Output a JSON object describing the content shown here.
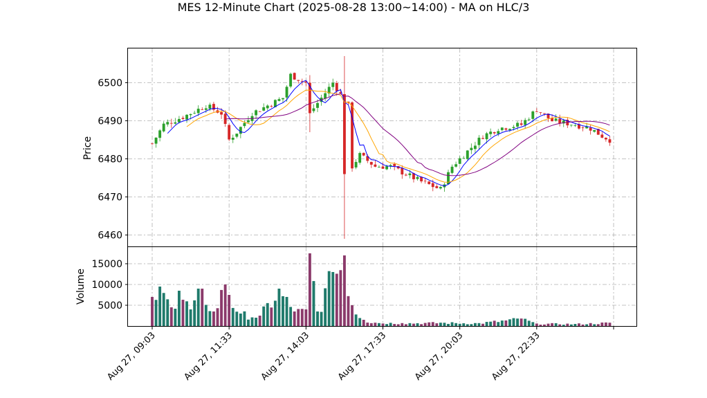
{
  "chart_data": {
    "type": "candlestick",
    "title": "MES 12-Minute Chart (2025-08-28 13:00~14:00) - MA on HLC/3",
    "price_panel": {
      "ylabel": "Price",
      "ylim": [
        6457,
        6509
      ],
      "yticks": [
        6460,
        6470,
        6480,
        6490,
        6500
      ],
      "ytick_labels": [
        "6460",
        "6470",
        "6480",
        "6490",
        "6500"
      ],
      "grid": true
    },
    "volume_panel": {
      "ylabel": "Volume",
      "ylim": [
        0,
        19000
      ],
      "yticks": [
        5000,
        10000,
        15000
      ],
      "ytick_labels": [
        "5000",
        "10000",
        "15000"
      ],
      "grid": true
    },
    "x_axis": {
      "bar_count": 120,
      "tick_indices": [
        0,
        20,
        40,
        60,
        80,
        100,
        120
      ],
      "tick_labels": [
        "Aug 27, 09:03",
        "Aug 27, 11:33",
        "Aug 27, 14:03",
        "Aug 27, 17:33",
        "Aug 27, 20:03",
        "Aug 27, 22:33",
        ""
      ]
    },
    "colors": {
      "up": "#2ca02c",
      "down": "#d62728",
      "vol_up": "#1f7a6b",
      "vol_down": "#8b3a6b",
      "ma_fast": "#0000ff",
      "ma_mid": "#ffa500",
      "ma_slow": "#800080",
      "grid": "#b0b0b0"
    },
    "close_anchors": [
      [
        0,
        6484
      ],
      [
        3,
        6489
      ],
      [
        8,
        6491
      ],
      [
        14,
        6494
      ],
      [
        18,
        6492
      ],
      [
        20,
        6485
      ],
      [
        22,
        6487
      ],
      [
        26,
        6492
      ],
      [
        32,
        6495
      ],
      [
        34,
        6496
      ],
      [
        36,
        6502
      ],
      [
        40,
        6500
      ],
      [
        41,
        6492
      ],
      [
        44,
        6496
      ],
      [
        47,
        6500
      ],
      [
        49,
        6497
      ],
      [
        51,
        6494
      ],
      [
        52,
        6478
      ],
      [
        54,
        6481
      ],
      [
        58,
        6478
      ],
      [
        62,
        6478
      ],
      [
        66,
        6476
      ],
      [
        70,
        6474
      ],
      [
        75,
        6472
      ],
      [
        78,
        6478
      ],
      [
        82,
        6482
      ],
      [
        86,
        6486
      ],
      [
        90,
        6488
      ],
      [
        96,
        6489
      ],
      [
        100,
        6493
      ],
      [
        104,
        6490
      ],
      [
        110,
        6489
      ],
      [
        114,
        6488
      ],
      [
        117,
        6486
      ],
      [
        119,
        6485
      ]
    ],
    "special_bars": [
      {
        "index": 50,
        "open": 6497,
        "high": 6507,
        "low": 6459,
        "close": 6476
      },
      {
        "index": 41,
        "open": 6500,
        "high": 6502,
        "low": 6487,
        "close": 6492
      }
    ],
    "volume_anchors": [
      [
        0,
        7000
      ],
      [
        2,
        9500
      ],
      [
        5,
        4500
      ],
      [
        7,
        8500
      ],
      [
        10,
        4000
      ],
      [
        13,
        9000
      ],
      [
        16,
        3500
      ],
      [
        19,
        10000
      ],
      [
        20,
        7500
      ],
      [
        23,
        3000
      ],
      [
        28,
        2500
      ],
      [
        33,
        9000
      ],
      [
        37,
        3500
      ],
      [
        40,
        4000
      ],
      [
        41,
        17500
      ],
      [
        43,
        3500
      ],
      [
        47,
        13000
      ],
      [
        50,
        17000
      ],
      [
        52,
        5000
      ],
      [
        55,
        1500
      ],
      [
        58,
        800
      ],
      [
        65,
        700
      ],
      [
        75,
        800
      ],
      [
        85,
        700
      ],
      [
        96,
        1800
      ],
      [
        100,
        600
      ],
      [
        110,
        500
      ],
      [
        119,
        800
      ]
    ],
    "ma_periods": [
      5,
      10,
      20
    ]
  }
}
